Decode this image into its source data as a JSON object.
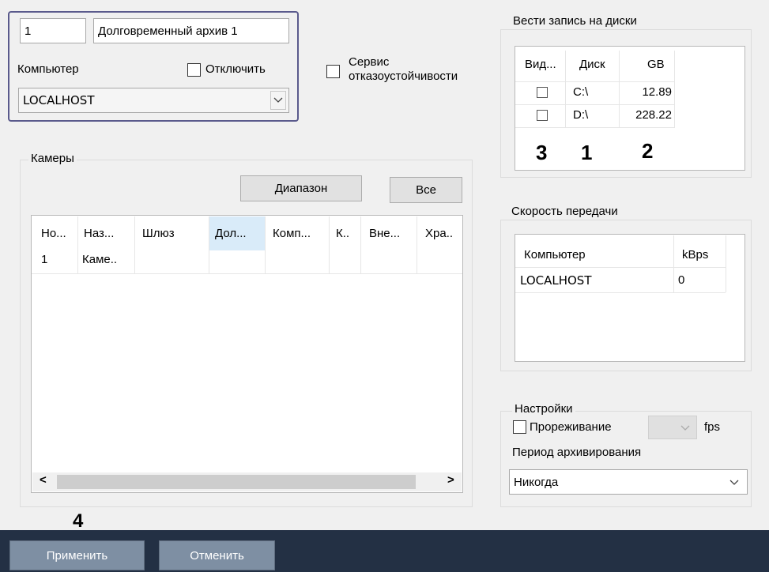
{
  "archive": {
    "number": "1",
    "name": "Долговременный архив 1",
    "computer_label": "Компьютер",
    "disable_label": "Отключить",
    "computer_value": "LOCALHOST"
  },
  "failover": {
    "line1": "Сервис",
    "line2": "отказоустойчивости"
  },
  "disks": {
    "title": "Вести запись на диски",
    "columns": [
      "Вид...",
      "Диск",
      "GB"
    ],
    "rows": [
      {
        "disk": "C:\\",
        "gb": "12.89"
      },
      {
        "disk": "D:\\",
        "gb": "228.22"
      }
    ]
  },
  "cameras": {
    "title": "Камеры",
    "range_button": "Диапазон",
    "all_button": "Все",
    "columns": [
      "Но...",
      "Наз...",
      "Шлюз",
      "Дол...",
      "Комп...",
      "К..",
      "Вне...",
      "Хра.."
    ],
    "rows": [
      [
        "1",
        "Каме..",
        "",
        "",
        "",
        "",
        "",
        ""
      ]
    ],
    "scroll_left": "<",
    "scroll_right": ">"
  },
  "speed": {
    "title": "Скорость передачи",
    "columns": [
      "Компьютер",
      "kBps"
    ],
    "rows": [
      [
        "LOCALHOST",
        "0"
      ]
    ]
  },
  "settings": {
    "title": "Настройки",
    "thinning_label": "Прореживание",
    "fps_label": "fps",
    "period_label": "Период архивирования",
    "period_value": "Никогда"
  },
  "footer": {
    "apply": "Применить",
    "cancel": "Отменить"
  },
  "annotations": [
    "1",
    "2",
    "3",
    "4"
  ],
  "colors": {
    "highlight_border": "#5a5a8c",
    "header_selected": "#d9ebf9",
    "footer_bar": "#233044",
    "footer_button": "#7e8fa3"
  }
}
